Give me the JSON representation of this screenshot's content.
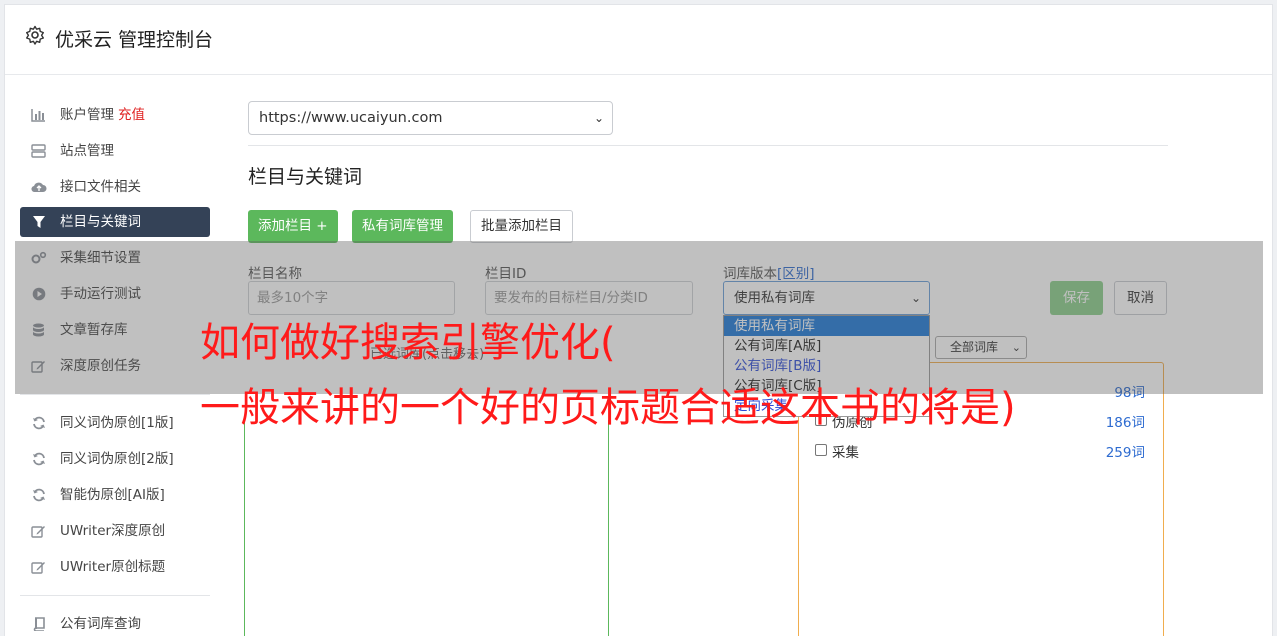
{
  "app": {
    "title": "优采云 管理控制台"
  },
  "sidebar": {
    "items": [
      {
        "label": "账户管理",
        "badge": "充值",
        "icon": "bar-chart-icon"
      },
      {
        "label": "站点管理",
        "icon": "server-icon"
      },
      {
        "label": "接口文件相关",
        "icon": "cloud-upload-icon"
      },
      {
        "label": "栏目与关键词",
        "icon": "filter-icon",
        "active": true
      },
      {
        "label": "采集细节设置",
        "icon": "gears-icon"
      },
      {
        "label": "手动运行测试",
        "icon": "play-circle-icon"
      },
      {
        "label": "文章暂存库",
        "icon": "database-icon"
      },
      {
        "label": "深度原创任务",
        "icon": "edit-icon"
      },
      {
        "label": "同义词伪原创[1版]",
        "icon": "refresh-icon"
      },
      {
        "label": "同义词伪原创[2版]",
        "icon": "refresh-icon"
      },
      {
        "label": "智能伪原创[AI版]",
        "icon": "refresh-icon"
      },
      {
        "label": "UWriter深度原创",
        "icon": "edit-icon"
      },
      {
        "label": "UWriter原创标题",
        "icon": "edit-icon"
      },
      {
        "label": "公有词库查询",
        "icon": "book-icon"
      }
    ]
  },
  "main": {
    "site_select": "https://www.ucaiyun.com",
    "section_title": "栏目与关键词",
    "buttons": {
      "add_column": "添加栏目 +",
      "private_lexicon": "私有词库管理",
      "batch_add": "批量添加栏目"
    },
    "form": {
      "name_label": "栏目名称",
      "name_placeholder": "最多10个字",
      "id_label": "栏目ID",
      "id_placeholder": "要发布的目标栏目/分类ID",
      "version_label": "词库版本",
      "version_link": "[区别]",
      "version_value": "使用私有词库",
      "save": "保存",
      "cancel": "取消"
    },
    "version_options": [
      "使用私有词库",
      "公有词库[A版]",
      "公有词库[B版]",
      "公有词库[C版]",
      "定向采集"
    ],
    "lexicon_filter": "全部词库",
    "left_panel_hint": "已选词库(点击移去)",
    "lexicon_rows": [
      {
        "name": "",
        "count": "98词"
      },
      {
        "name": "伪原创",
        "count": "186词"
      },
      {
        "name": "采集",
        "count": "259词"
      }
    ]
  },
  "caption": {
    "line1": "如何做好搜索引擎优化(",
    "line2": "一般来讲的一个好的页标题合适这本书的将是)"
  }
}
